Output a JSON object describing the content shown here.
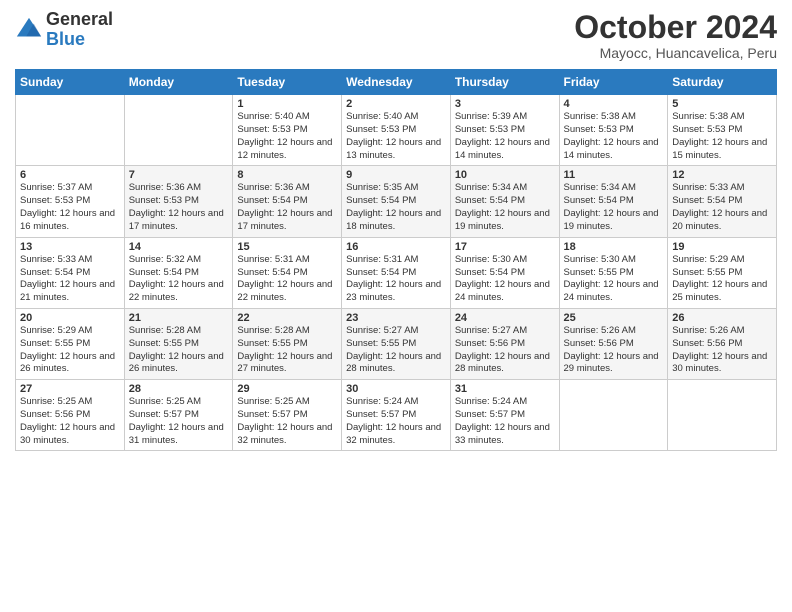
{
  "logo": {
    "general": "General",
    "blue": "Blue"
  },
  "header": {
    "month": "October 2024",
    "location": "Mayocc, Huancavelica, Peru"
  },
  "weekdays": [
    "Sunday",
    "Monday",
    "Tuesday",
    "Wednesday",
    "Thursday",
    "Friday",
    "Saturday"
  ],
  "weeks": [
    [
      {
        "day": "",
        "sunrise": "",
        "sunset": "",
        "daylight": ""
      },
      {
        "day": "",
        "sunrise": "",
        "sunset": "",
        "daylight": ""
      },
      {
        "day": "1",
        "sunrise": "Sunrise: 5:40 AM",
        "sunset": "Sunset: 5:53 PM",
        "daylight": "Daylight: 12 hours and 12 minutes."
      },
      {
        "day": "2",
        "sunrise": "Sunrise: 5:40 AM",
        "sunset": "Sunset: 5:53 PM",
        "daylight": "Daylight: 12 hours and 13 minutes."
      },
      {
        "day": "3",
        "sunrise": "Sunrise: 5:39 AM",
        "sunset": "Sunset: 5:53 PM",
        "daylight": "Daylight: 12 hours and 14 minutes."
      },
      {
        "day": "4",
        "sunrise": "Sunrise: 5:38 AM",
        "sunset": "Sunset: 5:53 PM",
        "daylight": "Daylight: 12 hours and 14 minutes."
      },
      {
        "day": "5",
        "sunrise": "Sunrise: 5:38 AM",
        "sunset": "Sunset: 5:53 PM",
        "daylight": "Daylight: 12 hours and 15 minutes."
      }
    ],
    [
      {
        "day": "6",
        "sunrise": "Sunrise: 5:37 AM",
        "sunset": "Sunset: 5:53 PM",
        "daylight": "Daylight: 12 hours and 16 minutes."
      },
      {
        "day": "7",
        "sunrise": "Sunrise: 5:36 AM",
        "sunset": "Sunset: 5:53 PM",
        "daylight": "Daylight: 12 hours and 17 minutes."
      },
      {
        "day": "8",
        "sunrise": "Sunrise: 5:36 AM",
        "sunset": "Sunset: 5:54 PM",
        "daylight": "Daylight: 12 hours and 17 minutes."
      },
      {
        "day": "9",
        "sunrise": "Sunrise: 5:35 AM",
        "sunset": "Sunset: 5:54 PM",
        "daylight": "Daylight: 12 hours and 18 minutes."
      },
      {
        "day": "10",
        "sunrise": "Sunrise: 5:34 AM",
        "sunset": "Sunset: 5:54 PM",
        "daylight": "Daylight: 12 hours and 19 minutes."
      },
      {
        "day": "11",
        "sunrise": "Sunrise: 5:34 AM",
        "sunset": "Sunset: 5:54 PM",
        "daylight": "Daylight: 12 hours and 19 minutes."
      },
      {
        "day": "12",
        "sunrise": "Sunrise: 5:33 AM",
        "sunset": "Sunset: 5:54 PM",
        "daylight": "Daylight: 12 hours and 20 minutes."
      }
    ],
    [
      {
        "day": "13",
        "sunrise": "Sunrise: 5:33 AM",
        "sunset": "Sunset: 5:54 PM",
        "daylight": "Daylight: 12 hours and 21 minutes."
      },
      {
        "day": "14",
        "sunrise": "Sunrise: 5:32 AM",
        "sunset": "Sunset: 5:54 PM",
        "daylight": "Daylight: 12 hours and 22 minutes."
      },
      {
        "day": "15",
        "sunrise": "Sunrise: 5:31 AM",
        "sunset": "Sunset: 5:54 PM",
        "daylight": "Daylight: 12 hours and 22 minutes."
      },
      {
        "day": "16",
        "sunrise": "Sunrise: 5:31 AM",
        "sunset": "Sunset: 5:54 PM",
        "daylight": "Daylight: 12 hours and 23 minutes."
      },
      {
        "day": "17",
        "sunrise": "Sunrise: 5:30 AM",
        "sunset": "Sunset: 5:54 PM",
        "daylight": "Daylight: 12 hours and 24 minutes."
      },
      {
        "day": "18",
        "sunrise": "Sunrise: 5:30 AM",
        "sunset": "Sunset: 5:55 PM",
        "daylight": "Daylight: 12 hours and 24 minutes."
      },
      {
        "day": "19",
        "sunrise": "Sunrise: 5:29 AM",
        "sunset": "Sunset: 5:55 PM",
        "daylight": "Daylight: 12 hours and 25 minutes."
      }
    ],
    [
      {
        "day": "20",
        "sunrise": "Sunrise: 5:29 AM",
        "sunset": "Sunset: 5:55 PM",
        "daylight": "Daylight: 12 hours and 26 minutes."
      },
      {
        "day": "21",
        "sunrise": "Sunrise: 5:28 AM",
        "sunset": "Sunset: 5:55 PM",
        "daylight": "Daylight: 12 hours and 26 minutes."
      },
      {
        "day": "22",
        "sunrise": "Sunrise: 5:28 AM",
        "sunset": "Sunset: 5:55 PM",
        "daylight": "Daylight: 12 hours and 27 minutes."
      },
      {
        "day": "23",
        "sunrise": "Sunrise: 5:27 AM",
        "sunset": "Sunset: 5:55 PM",
        "daylight": "Daylight: 12 hours and 28 minutes."
      },
      {
        "day": "24",
        "sunrise": "Sunrise: 5:27 AM",
        "sunset": "Sunset: 5:56 PM",
        "daylight": "Daylight: 12 hours and 28 minutes."
      },
      {
        "day": "25",
        "sunrise": "Sunrise: 5:26 AM",
        "sunset": "Sunset: 5:56 PM",
        "daylight": "Daylight: 12 hours and 29 minutes."
      },
      {
        "day": "26",
        "sunrise": "Sunrise: 5:26 AM",
        "sunset": "Sunset: 5:56 PM",
        "daylight": "Daylight: 12 hours and 30 minutes."
      }
    ],
    [
      {
        "day": "27",
        "sunrise": "Sunrise: 5:25 AM",
        "sunset": "Sunset: 5:56 PM",
        "daylight": "Daylight: 12 hours and 30 minutes."
      },
      {
        "day": "28",
        "sunrise": "Sunrise: 5:25 AM",
        "sunset": "Sunset: 5:57 PM",
        "daylight": "Daylight: 12 hours and 31 minutes."
      },
      {
        "day": "29",
        "sunrise": "Sunrise: 5:25 AM",
        "sunset": "Sunset: 5:57 PM",
        "daylight": "Daylight: 12 hours and 32 minutes."
      },
      {
        "day": "30",
        "sunrise": "Sunrise: 5:24 AM",
        "sunset": "Sunset: 5:57 PM",
        "daylight": "Daylight: 12 hours and 32 minutes."
      },
      {
        "day": "31",
        "sunrise": "Sunrise: 5:24 AM",
        "sunset": "Sunset: 5:57 PM",
        "daylight": "Daylight: 12 hours and 33 minutes."
      },
      {
        "day": "",
        "sunrise": "",
        "sunset": "",
        "daylight": ""
      },
      {
        "day": "",
        "sunrise": "",
        "sunset": "",
        "daylight": ""
      }
    ]
  ]
}
